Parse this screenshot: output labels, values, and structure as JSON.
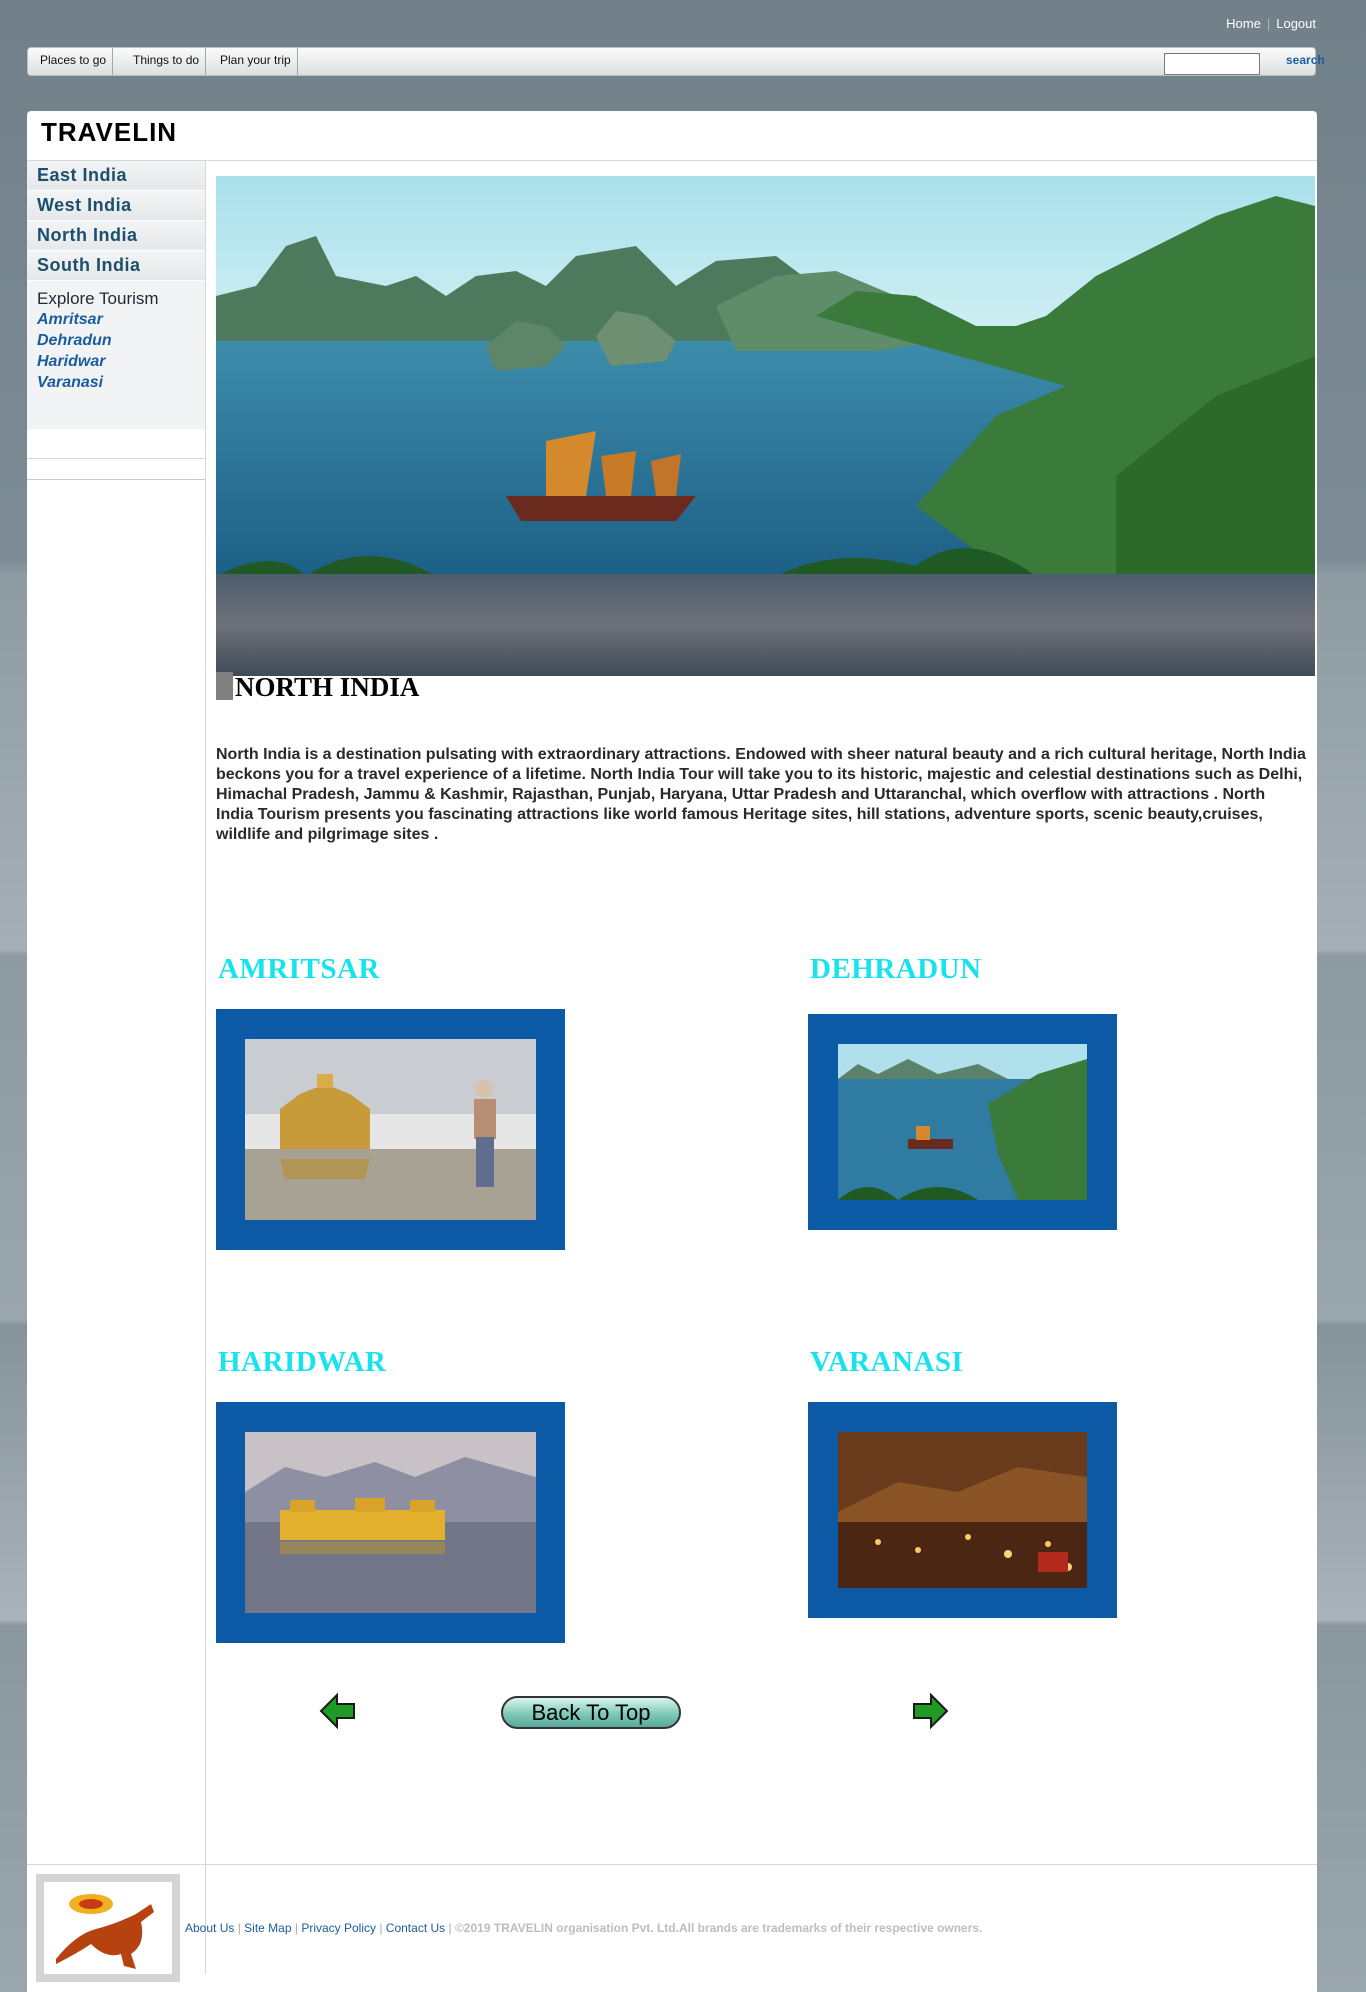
{
  "top_links": {
    "home": "Home",
    "logout": "Logout"
  },
  "nav": {
    "items": [
      "Places to go",
      "Things to do",
      "Plan your trip"
    ],
    "search_label": "search"
  },
  "brand": "TRAVELIN",
  "sidebar": {
    "regions": [
      "East India",
      "West India",
      "North India",
      "South India"
    ],
    "explore_title": "Explore Tourism",
    "explore_links": [
      "Amritsar",
      "Dehradun",
      "Haridwar",
      "Varanasi"
    ]
  },
  "section_title": "NORTH INDIA",
  "intro": "North India is a destination pulsating with extraordinary attractions. Endowed with sheer natural beauty and a rich cultural heritage, North India beckons you for a travel experience of a lifetime. North India Tour will take you to its historic, majestic and celestial destinations such as Delhi, Himachal Pradesh, Jammu & Kashmir, Rajasthan, Punjab, Haryana, Uttar Pradesh and Uttaranchal, which overflow with attractions . North India Tourism presents you fascinating attractions like world famous Heritage sites, hill stations, adventure sports, scenic beauty,cruises, wildlife and pilgrimage sites .",
  "cities": [
    "AMRITSAR",
    "DEHRADUN",
    "HARIDWAR",
    "VARANASI"
  ],
  "back_to_top": "Back To Top",
  "footer": {
    "links": [
      "About Us",
      "Site Map",
      "Privacy Policy",
      "Contact Us"
    ],
    "copyright": "©2019 TRAVELIN organisation Pvt. Ltd.All brands are trademarks of their respective owners."
  }
}
